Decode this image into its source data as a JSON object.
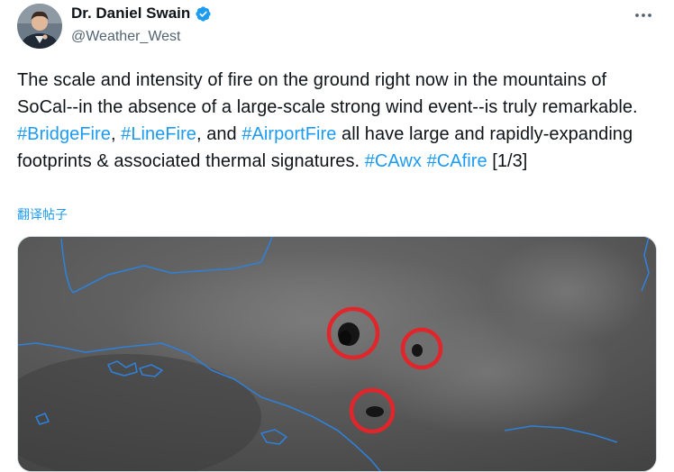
{
  "author": {
    "display_name": "Dr. Daniel Swain",
    "handle": "@Weather_West",
    "verified": true,
    "avatar_icon": "profile-photo"
  },
  "more_icon": "ellipsis-icon",
  "tweet": {
    "segments": [
      {
        "text": "The scale and intensity of fire on the ground right now in the mountains of SoCal--in the absence of a large-scale strong wind event--is truly remarkable. ",
        "type": "text"
      },
      {
        "text": "#BridgeFire",
        "type": "hashtag"
      },
      {
        "text": ", ",
        "type": "text"
      },
      {
        "text": "#LineFire",
        "type": "hashtag"
      },
      {
        "text": ", and ",
        "type": "text"
      },
      {
        "text": "#AirportFire",
        "type": "hashtag"
      },
      {
        "text": " all have large and rapidly-expanding footprints & associated thermal signatures. ",
        "type": "text"
      },
      {
        "text": "#CAwx",
        "type": "hashtag"
      },
      {
        "text": " ",
        "type": "text"
      },
      {
        "text": "#CAfire",
        "type": "hashtag"
      },
      {
        "text": " [1/3]",
        "type": "text"
      }
    ]
  },
  "translate_label": "翻译帖子",
  "colors": {
    "hashtag": "#1d9bf0",
    "verified": "#1d9bf0",
    "coastline": "#2f80d6",
    "fire_circle": "#e0262b",
    "satellite_bg": "#525252"
  },
  "media": {
    "kind": "satellite-image",
    "hotspot_count": 3
  }
}
